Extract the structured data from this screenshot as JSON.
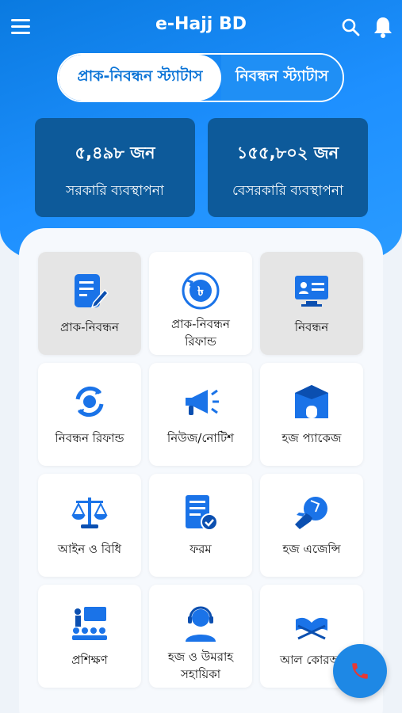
{
  "app_title": "e-Hajj BD",
  "toggle": {
    "active_label": "প্রাক-নিবন্ধন স্ট্যাটাস",
    "inactive_label": "নিবন্ধন স্ট্যাটাস"
  },
  "stats": [
    {
      "value": "৫,৪৯৮ জন",
      "label": "সরকারি ব্যবস্থাপনা"
    },
    {
      "value": "১৫৫,৮০২ জন",
      "label": "বেসরকারি ব্যবস্থাপনা"
    }
  ],
  "menu": [
    {
      "label": "প্রাক-নিবন্ধন",
      "icon": "document-edit-icon"
    },
    {
      "label": "প্রাক-নিবন্ধন",
      "label2": "রিফান্ড",
      "icon": "taka-refund-icon"
    },
    {
      "label": "নিবন্ধন",
      "icon": "id-card-monitor-icon"
    },
    {
      "label": "নিবন্ধন রিফান্ড",
      "icon": "refund-cycle-icon"
    },
    {
      "label": "নিউজ/নোটিশ",
      "icon": "megaphone-icon"
    },
    {
      "label": "হজ প্যাকেজ",
      "icon": "kaaba-icon"
    },
    {
      "label": "আইন ও বিধি",
      "icon": "scales-icon"
    },
    {
      "label": "ফরম",
      "icon": "form-check-icon"
    },
    {
      "label": "হজ এজেন্সি",
      "icon": "travel-agency-icon"
    },
    {
      "label": "প্রশিক্ষণ",
      "icon": "training-icon"
    },
    {
      "label": "হজ ও উমরাহ",
      "label2": "সহায়িকা",
      "icon": "support-agent-icon"
    },
    {
      "label": "আল কোরআ",
      "icon": "quran-icon"
    }
  ],
  "colors": {
    "primary": "#1e88e5",
    "card_dark": "#0d5a9a",
    "icon_blue": "#1a73e8"
  }
}
